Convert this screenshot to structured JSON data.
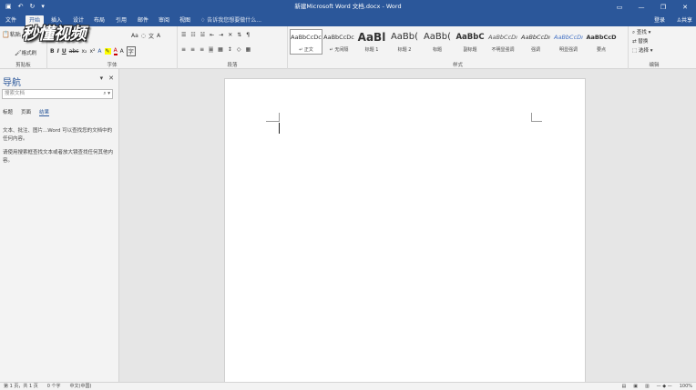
{
  "titlebar": {
    "title": "新建Microsoft Word 文档.docx - Word",
    "save_icon": "save-icon",
    "undo_icon": "undo-icon",
    "redo_icon": "redo-icon",
    "customize_icon": "customize-icon",
    "ribbon_display": "▭",
    "minimize": "—",
    "restore": "❐",
    "close": "✕"
  },
  "tabs": {
    "file": "文件",
    "home": "开始",
    "insert": "插入",
    "design": "设计",
    "layout": "布局",
    "references": "引用",
    "mailings": "邮件",
    "review": "审阅",
    "view": "视图",
    "tell_me": "告诉我您想要做什么...",
    "login": "登录",
    "share": "共享"
  },
  "ribbon": {
    "clipboard": {
      "label": "剪贴板",
      "paste": "粘贴",
      "format_painter": "格式刷"
    },
    "font": {
      "label": "字体",
      "font_size_glyph": "Aa",
      "bold": "B",
      "italic": "I",
      "underline": "U",
      "strikethrough": "abc",
      "subscript": "x₂",
      "superscript": "x²",
      "font_color": "A"
    },
    "paragraph": {
      "label": "段落"
    },
    "styles": {
      "label": "样式",
      "items": [
        {
          "preview": "AaBbCcDc",
          "name": "↵ 正文"
        },
        {
          "preview": "AaBbCcDc",
          "name": "↵ 无间隔"
        },
        {
          "preview": "AaBl",
          "name": "标题 1"
        },
        {
          "preview": "AaBb(",
          "name": "标题 2"
        },
        {
          "preview": "AaBb(",
          "name": "标题"
        },
        {
          "preview": "AaBbC",
          "name": "副标题"
        },
        {
          "preview": "AaBbCcDı",
          "name": "不明显强调"
        },
        {
          "preview": "AaBbCcDı",
          "name": "强调"
        },
        {
          "preview": "AaBbCcDı",
          "name": "明显强调"
        },
        {
          "preview": "AaBbCcD",
          "name": "要点"
        }
      ]
    },
    "editing": {
      "label": "编辑",
      "find": "查找",
      "replace": "替换",
      "select": "选择"
    }
  },
  "watermark": "秒懂视频",
  "nav": {
    "title": "导航",
    "search_placeholder": "搜索文档",
    "tabs": [
      "标题",
      "页面",
      "结果"
    ],
    "msg1": "文本、批注、图片...Word 可以查找您的文档中的任何内容。",
    "msg2": "请使用搜索框查找文本或者放大镜查找任何其他内容。"
  },
  "status": {
    "page": "第 1 页，共 1 页",
    "words": "0 个字",
    "lang": "中文(中国)",
    "zoom": "100%"
  }
}
